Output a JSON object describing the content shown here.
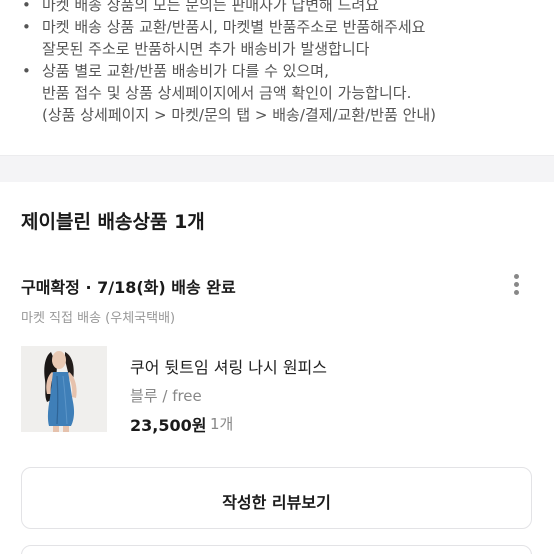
{
  "notice": {
    "lines": [
      {
        "bullet": "•",
        "text": "마켓 배송 상품의 모든 문의는 판매자가 답변해 드려요"
      },
      {
        "bullet": "•",
        "text": "마켓 배송 상품 교환/반품시, 마켓별 반품주소로 반품해주세요"
      },
      {
        "bullet": "",
        "text": "잘못된 주소로 반품하시면 추가 배송비가 발생합니다"
      },
      {
        "bullet": "•",
        "text": "상품 별로 교환/반품 배송비가 다를 수 있으며,"
      },
      {
        "bullet": "",
        "text": "반품 접수 및 상품 상세페이지에서 금액 확인이 가능합니다."
      },
      {
        "bullet": "",
        "text": "(상품 상세페이지 > 마켓/문의 탭 > 배송/결제/교환/반품 안내)"
      }
    ]
  },
  "order": {
    "section_title": "제이블린 배송상품 1개",
    "status": "구매확정 · 7/18(화) 배송 완료",
    "shipping": "마켓 직접 배송 (우체국택배)",
    "more_icon": "more-vertical-icon"
  },
  "product": {
    "name": "쿠어 뒷트임 셔링 나시 원피스",
    "option": "블루 / free",
    "price": "23,500원",
    "quantity": "1개"
  },
  "actions": {
    "review_button": "작성한 리뷰보기"
  },
  "colors": {
    "background": "#ffffff",
    "divider_band": "#f4f4f6",
    "text_primary": "#1a1a1a",
    "text_secondary": "#888888",
    "dress_blue": "#3f7fb8"
  }
}
